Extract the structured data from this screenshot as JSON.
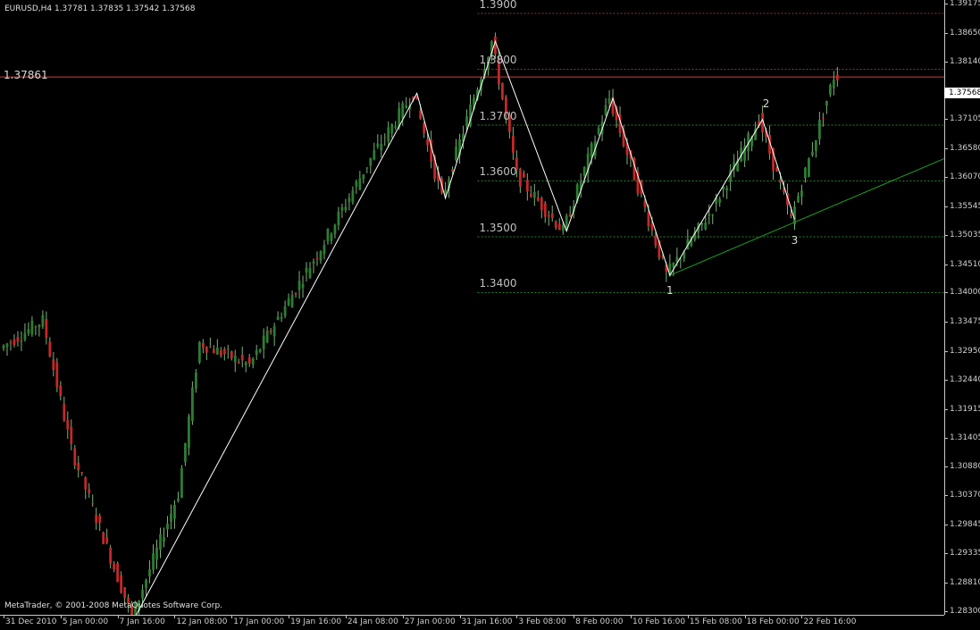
{
  "window": {
    "symbol_info": "EURUSD,H4  1.37781 1.37835 1.37542 1.37568",
    "copyright": "MetaTrader, © 2001-2008 MetaQuotes Software Corp."
  },
  "price_axis": {
    "labels": [
      "1.39175",
      "1.38650",
      "1.38140",
      "1.37568",
      "1.37105",
      "1.36580",
      "1.36070",
      "1.35545",
      "1.35035",
      "1.34510",
      "1.34000",
      "1.33475",
      "1.32950",
      "1.32440",
      "1.31915",
      "1.31405",
      "1.30880",
      "1.30370",
      "1.29845",
      "1.29335",
      "1.28810",
      "1.28300"
    ],
    "values": [
      1.39175,
      1.3865,
      1.3814,
      1.37568,
      1.37105,
      1.3658,
      1.3607,
      1.35545,
      1.35035,
      1.3451,
      1.34,
      1.33475,
      1.3295,
      1.3244,
      1.31915,
      1.31405,
      1.3088,
      1.3037,
      1.29845,
      1.29335,
      1.2881,
      1.283
    ],
    "current_price": "1.37568",
    "range": [
      1.2823,
      1.3924
    ]
  },
  "time_axis": {
    "labels": [
      "31 Dec 2010",
      "5 Jan 00:00",
      "7 Jan 16:00",
      "12 Jan 08:00",
      "17 Jan 00:00",
      "19 Jan 16:00",
      "24 Jan 08:00",
      "27 Jan 00:00",
      "31 Jan 16:00",
      "3 Feb 08:00",
      "8 Feb 00:00",
      "10 Feb 16:00",
      "15 Feb 08:00",
      "18 Feb 00:00",
      "22 Feb 16:00"
    ],
    "bar_index": [
      0,
      16,
      32,
      48,
      64,
      80,
      96,
      112,
      128,
      144,
      160,
      176,
      192,
      208,
      224
    ]
  },
  "fib_levels": [
    {
      "label": "1.3900",
      "price": 1.39
    },
    {
      "label": "1.3800",
      "price": 1.38
    },
    {
      "label": "1.3700",
      "price": 1.37
    },
    {
      "label": "1.3600",
      "price": 1.36
    },
    {
      "label": "1.3500",
      "price": 1.35
    },
    {
      "label": "1.3400",
      "price": 1.34
    }
  ],
  "horizontal_line": {
    "label": "1.37861",
    "price": 1.37861
  },
  "zigzag_points": [
    {
      "bar": 37,
      "price": 1.282
    },
    {
      "bar": 116,
      "price": 1.3757
    },
    {
      "bar": 124,
      "price": 1.3569
    },
    {
      "bar": 138,
      "price": 1.385
    },
    {
      "bar": 158,
      "price": 1.351
    },
    {
      "bar": 171,
      "price": 1.3748
    },
    {
      "bar": 187,
      "price": 1.3431
    },
    {
      "bar": 213,
      "price": 1.371
    },
    {
      "bar": 222,
      "price": 1.3531
    }
  ],
  "wave_labels": [
    {
      "text": "1",
      "bar": 187,
      "price": 1.342
    },
    {
      "text": "2",
      "bar": 214,
      "price": 1.3732
    },
    {
      "text": "3",
      "bar": 222,
      "price": 1.351
    }
  ],
  "trend_line": {
    "from": {
      "bar": 187,
      "price": 1.3431
    },
    "to": {
      "bar": 264,
      "price": 1.364
    }
  },
  "colors": {
    "background": "#000000",
    "bull_candle": "#2e7d32",
    "bear_candle": "#c62828",
    "wick": "#7cb37c",
    "fib_line": "#2f7f2f",
    "resistance_line": "#c84040",
    "trend_line": "#1f9d1f",
    "zigzag": "#ffffff"
  },
  "chart_data": {
    "type": "candlestick",
    "symbol": "EURUSD",
    "timeframe": "H4",
    "key_prices": [
      {
        "bar": 0,
        "price": 1.33
      },
      {
        "bar": 12,
        "price": 1.335
      },
      {
        "bar": 20,
        "price": 1.312
      },
      {
        "bar": 37,
        "price": 1.282
      },
      {
        "bar": 50,
        "price": 1.304
      },
      {
        "bar": 56,
        "price": 1.331
      },
      {
        "bar": 70,
        "price": 1.327
      },
      {
        "bar": 90,
        "price": 1.348
      },
      {
        "bar": 104,
        "price": 1.364
      },
      {
        "bar": 116,
        "price": 1.3757
      },
      {
        "bar": 124,
        "price": 1.3569
      },
      {
        "bar": 138,
        "price": 1.385
      },
      {
        "bar": 145,
        "price": 1.361
      },
      {
        "bar": 158,
        "price": 1.351
      },
      {
        "bar": 171,
        "price": 1.3748
      },
      {
        "bar": 187,
        "price": 1.3431
      },
      {
        "bar": 200,
        "price": 1.355
      },
      {
        "bar": 213,
        "price": 1.371
      },
      {
        "bar": 222,
        "price": 1.3531
      },
      {
        "bar": 234,
        "price": 1.3787
      }
    ],
    "ylim": [
      1.2823,
      1.3924
    ],
    "xlim_bars": [
      0,
      264
    ]
  }
}
